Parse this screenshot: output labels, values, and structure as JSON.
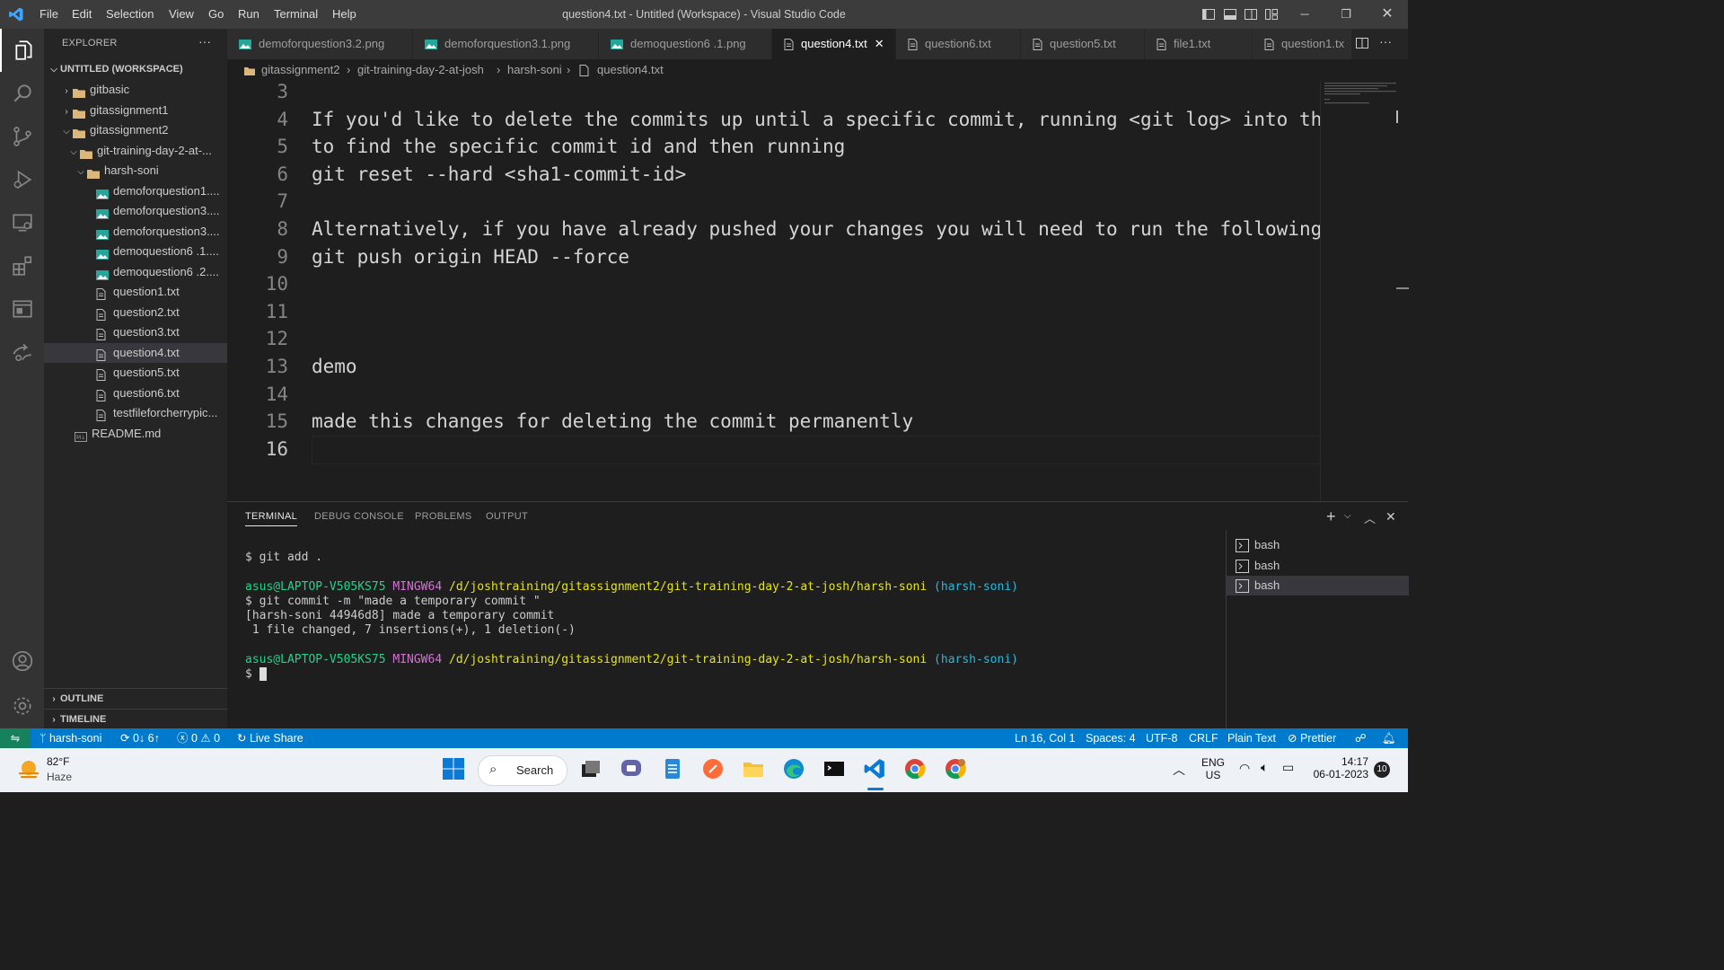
{
  "titlebar": {
    "menu": [
      "File",
      "Edit",
      "Selection",
      "View",
      "Go",
      "Run",
      "Terminal",
      "Help"
    ],
    "title": "question4.txt - Untitled (Workspace) - Visual Studio Code"
  },
  "sidebar": {
    "title": "EXPLORER",
    "more": "···",
    "workspace": "UNTITLED (WORKSPACE)",
    "tree": [
      {
        "label": "gitbasic",
        "type": "folder-root",
        "depth": 1,
        "expanded": false
      },
      {
        "label": "gitassignment1",
        "type": "folder-root",
        "depth": 1,
        "expanded": false
      },
      {
        "label": "gitassignment2",
        "type": "folder-root",
        "depth": 1,
        "expanded": true
      },
      {
        "label": "git-training-day-2-at-...",
        "type": "folder",
        "depth": 2,
        "expanded": true
      },
      {
        "label": "harsh-soni",
        "type": "folder",
        "depth": 3,
        "expanded": true
      },
      {
        "label": "demoforquestion1....",
        "type": "image",
        "depth": 4
      },
      {
        "label": "demoforquestion3....",
        "type": "image",
        "depth": 4
      },
      {
        "label": "demoforquestion3....",
        "type": "image",
        "depth": 4
      },
      {
        "label": "demoquestion6 .1....",
        "type": "image",
        "depth": 4
      },
      {
        "label": "demoquestion6 .2....",
        "type": "image",
        "depth": 4
      },
      {
        "label": "question1.txt",
        "type": "text",
        "depth": 4
      },
      {
        "label": "question2.txt",
        "type": "text",
        "depth": 4
      },
      {
        "label": "question3.txt",
        "type": "text",
        "depth": 4
      },
      {
        "label": "question4.txt",
        "type": "text",
        "depth": 4,
        "selected": true
      },
      {
        "label": "question5.txt",
        "type": "text",
        "depth": 4
      },
      {
        "label": "question6.txt",
        "type": "text",
        "depth": 4
      },
      {
        "label": "testfileforcherrypic...",
        "type": "text",
        "depth": 4
      },
      {
        "label": "README.md",
        "type": "md",
        "depth": 3
      }
    ],
    "outline": "OUTLINE",
    "timeline": "TIMELINE"
  },
  "tabs": [
    {
      "label": "demoforquestion3.2.png",
      "type": "image"
    },
    {
      "label": "demoforquestion3.1.png",
      "type": "image"
    },
    {
      "label": "demoquestion6 .1.png",
      "type": "image"
    },
    {
      "label": "question4.txt",
      "type": "text",
      "active": true
    },
    {
      "label": "question6.txt",
      "type": "text"
    },
    {
      "label": "question5.txt",
      "type": "text"
    },
    {
      "label": "file1.txt",
      "type": "text"
    },
    {
      "label": "question1.tx",
      "type": "text"
    }
  ],
  "breadcrumb": [
    "gitassignment2",
    "git-training-day-2-at-josh",
    "harsh-soni",
    "question4.txt"
  ],
  "editor": {
    "lines": [
      {
        "n": "3",
        "text": ""
      },
      {
        "n": "4",
        "text": "If you'd like to delete the commits up until a specific commit, running <git log> into the"
      },
      {
        "n": "5",
        "text": "to find the specific commit id and then running"
      },
      {
        "n": "6",
        "text": "git reset --hard <sha1-commit-id>"
      },
      {
        "n": "7",
        "text": ""
      },
      {
        "n": "8",
        "text": "Alternatively, if you have already pushed your changes you will need to run the following c"
      },
      {
        "n": "9",
        "text": "git push origin HEAD --force"
      },
      {
        "n": "10",
        "text": ""
      },
      {
        "n": "11",
        "text": ""
      },
      {
        "n": "12",
        "text": ""
      },
      {
        "n": "13",
        "text": "demo"
      },
      {
        "n": "14",
        "text": ""
      },
      {
        "n": "15",
        "text": "made this changes for deleting the commit permanently"
      },
      {
        "n": "16",
        "text": ""
      }
    ],
    "current_line": "16"
  },
  "panel": {
    "tabs": [
      "TERMINAL",
      "DEBUG CONSOLE",
      "PROBLEMS",
      "OUTPUT"
    ],
    "terminal": {
      "cmd1": "$ git add .",
      "prompt_user": "asus@LAPTOP-V505KS75",
      "prompt_sys": "MINGW64",
      "prompt_path": "/d/joshtraining/gitassignment2/git-training-day-2-at-josh/harsh-soni",
      "prompt_branch": "(harsh-soni)",
      "cmd2": "$ git commit -m \"made a temporary commit \"",
      "out1": "[harsh-soni 44946d8] made a temporary commit",
      "out2": " 1 file changed, 7 insertions(+), 1 deletion(-)",
      "cmd3": "$ "
    },
    "terminals": [
      "bash",
      "bash",
      "bash"
    ],
    "selected_terminal": 2
  },
  "statusbar": {
    "branch": "harsh-soni",
    "sync": "0↓ 6↑",
    "errors": "0",
    "warnings": "0",
    "liveshare": "Live Share",
    "position": "Ln 16, Col 1",
    "spaces": "Spaces: 4",
    "encoding": "UTF-8",
    "eol": "CRLF",
    "language": "Plain Text",
    "prettier": "Prettier"
  },
  "taskbar": {
    "weather_temp": "82°F",
    "weather_desc": "Haze",
    "search": "Search",
    "lang1": "ENG",
    "lang2": "US",
    "time": "14:17",
    "date": "06-01-2023",
    "notif": "10"
  },
  "colors": {
    "accent": "#007acc",
    "folder": "#dcb67a",
    "image_icon": "#26a69a"
  }
}
